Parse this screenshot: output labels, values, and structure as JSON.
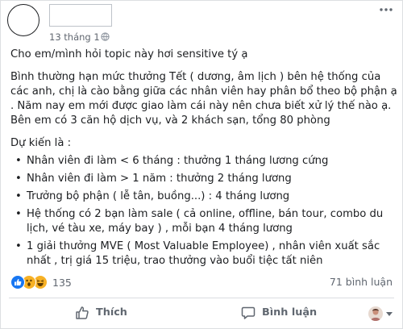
{
  "post": {
    "timestamp": "13 tháng 1",
    "paragraphs": [
      "Cho em/mình hỏi topic này hơi sensitive tý ạ",
      "Bình thường hạn mức thưởng Tết ( dương, âm lịch ) bên hệ thống của các anh, chị là cào bằng giữa các nhân viên hay phân bổ theo bộ phận ạ . Năm nay em mới được giao làm cái này nên chưa biết xử lý thế nào ạ. Bên em có 3 căn hộ dịch vụ, và 2 khách sạn, tổng 80 phòng"
    ],
    "list_title": "Dự kiến là :",
    "list_items": [
      "Nhân viên đi làm < 6 tháng : thưởng 1 tháng lương cứng",
      "Nhân viên đi làm > 1 năm : thưởng 2 tháng lương",
      "Trưởng bộ phận ( lễ tân, buồng...) : 4 tháng lương",
      "Hệ thống có 2 bạn làm sale ( cả online, offline, bán tour, combo du lịch,  vé tàu xe, máy bay ) , mỗi bạn 4 tháng lương",
      "1 giải thưởng MVE ( Most Valuable Employee) , nhân viên xuất sắc nhất , trị giá 15 triệu, trao thưởng vào buổi tiệc tất niên"
    ]
  },
  "footer": {
    "reaction_count": "135",
    "comment_count": "71 bình luận",
    "like_label": "Thích",
    "comment_label": "Bình luận"
  },
  "icons": {
    "privacy": "globe-icon",
    "more": "more-icon",
    "like": "thumbs-up-icon",
    "comment": "comment-icon",
    "reactions": [
      "like-reaction-icon",
      "wow-reaction-icon",
      "haha-reaction-icon"
    ]
  },
  "colors": {
    "like_blue": "#1877f2",
    "reaction_yellow": "#f7b125",
    "secondary_text": "#606770"
  }
}
